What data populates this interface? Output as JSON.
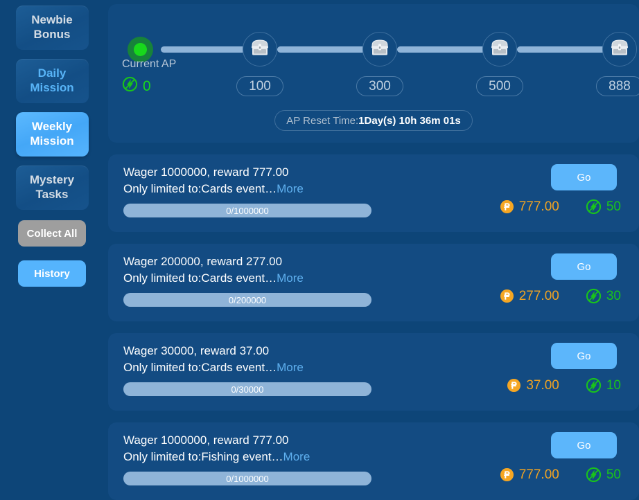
{
  "sidebar": {
    "tabs": [
      {
        "line1": "Newbie",
        "line2": "Bonus",
        "state": "idle",
        "name": "sidebar-tab-newbie-bonus"
      },
      {
        "line1": "Daily",
        "line2": "Mission",
        "state": "idle-blue",
        "name": "sidebar-tab-daily-mission"
      },
      {
        "line1": "Weekly",
        "line2": "Mission",
        "state": "active",
        "name": "sidebar-tab-weekly-mission"
      },
      {
        "line1": "Mystery",
        "line2": "Tasks",
        "state": "idle",
        "name": "sidebar-tab-mystery-tasks"
      }
    ],
    "collect_all_label": "Collect All",
    "history_label": "History"
  },
  "ap_panel": {
    "current_label": "Current AP",
    "current_value": "0",
    "current_icon": "ap-lightning-icon",
    "milestones": [
      {
        "value": "100",
        "icon": "treasure-chest-icon"
      },
      {
        "value": "300",
        "icon": "treasure-chest-icon"
      },
      {
        "value": "500",
        "icon": "treasure-chest-icon"
      },
      {
        "value": "888",
        "icon": "treasure-chest-icon"
      }
    ],
    "reset_prefix": "AP Reset Time:",
    "reset_time": "1Day(s) 10h 36m 01s"
  },
  "missions": [
    {
      "title": "Wager 1000000, reward 777.00",
      "subtitle": "Only limited to:Cards event…",
      "more_label": "More",
      "progress_text": "0/1000000",
      "progress_percent": 0,
      "go_label": "Go",
      "coin_reward": "777.00",
      "ap_reward": "50"
    },
    {
      "title": "Wager 200000, reward 277.00",
      "subtitle": "Only limited to:Cards event…",
      "more_label": "More",
      "progress_text": "0/200000",
      "progress_percent": 0,
      "go_label": "Go",
      "coin_reward": "277.00",
      "ap_reward": "30"
    },
    {
      "title": "Wager 30000, reward 37.00",
      "subtitle": "Only limited to:Cards event…",
      "more_label": "More",
      "progress_text": "0/30000",
      "progress_percent": 0,
      "go_label": "Go",
      "coin_reward": "37.00",
      "ap_reward": "10"
    },
    {
      "title": "Wager 1000000, reward 777.00",
      "subtitle": "Only limited to:Fishing event…",
      "more_label": "More",
      "progress_text": "0/1000000",
      "progress_percent": 0,
      "go_label": "Go",
      "coin_reward": "777.00",
      "ap_reward": "50"
    }
  ],
  "colors": {
    "page_bg": "#0d4578",
    "card_bg": "#134b82",
    "accent_blue": "#55b4fd",
    "coin_orange": "#f0a322",
    "ap_green": "#19c41b",
    "track_blue": "#8fb4d8",
    "muted_text": "#b9c8d8"
  }
}
